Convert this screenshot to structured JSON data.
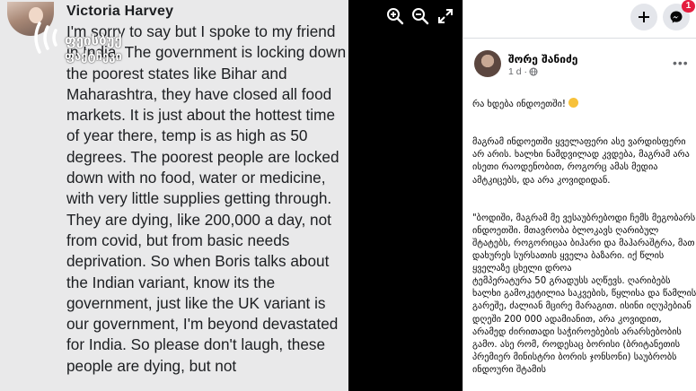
{
  "photo": {
    "author": "Victoria Harvey",
    "post_text": "I'm sorry to say but I spoke to my friend in India. The government is locking down the poorest states like Bihar and Maharashtra, they have closed all food markets. It is just about the hottest time of year there, temp is as high as 50 degrees. The poorest people are locked down with no food, water or medicine, with very little supplies getting through. They are dying, like 200,000 a day, not from covid, but from basic needs deprivation. So when Boris talks about the Indian variant, know its the government, just like the UK variant is our government, I'm beyond devastated for India. So please don't laugh, these people are dying, but not",
    "watermark": {
      "line1": "ფეისბუქ",
      "line2": "ფაქტჩეკი"
    }
  },
  "viewer_controls": {
    "zoom_in_icon": "zoom-in-icon",
    "zoom_out_icon": "zoom-out-icon",
    "fullscreen_icon": "fullscreen-icon"
  },
  "fb_header": {
    "plus_icon": "plus-icon",
    "messenger_icon": "messenger-icon",
    "notification_count": "1"
  },
  "post": {
    "poster_name": "შორე შანიძე",
    "meta": "1 d ·",
    "more_icon": "more-dots-icon",
    "paragraph1": "რა ხდება ინდოეთში!",
    "paragraph2": "მაგრამ ინდოეთში ყველაფერი ასე ვარდისფერი არ არის. ხალხი ნამდვილად კვდება, მაგრამ არა ისეთი რაოდენობით, როგორც ამას მედია ამტკიცებს, და არა კოვიდიდან.",
    "paragraph3": "\"ბოდიში, მაგრამ მე ვესაუბრებოდი ჩემს მეგობარს ინდოეთში. მთავრობა ბლოკავს ღარიბულ შტატებს, როგორიცაა ბიჰარი და მაჰარაშტრა, მათ დახურეს სურსათის ყველა ბაზარი. იქ წლის ყველაზე ცხელი დროა\nტემპერატურა 50 გრადუსს აღწევს. ღარიბებს ხალხი გამოკეტილია საკვების, წყლისა და წამლის გარეშე, ძალიან მცირე მარაგით. ისინი იღუპებიან დღეში 200 000 ადამიანით, არა კოვიდით, არამედ ძირითადი საჭიროებების არარსებობის გამო. ასე რომ, როდესაც ბორისი (ბრიტანეთის პრემიერ მინისტრი ბორის ჯონსონი) საუბრობს ინდოური შტამის"
  },
  "colors": {
    "accent": "#1877f2",
    "badge": "#e41e3f",
    "viewer_bg": "#000000"
  }
}
